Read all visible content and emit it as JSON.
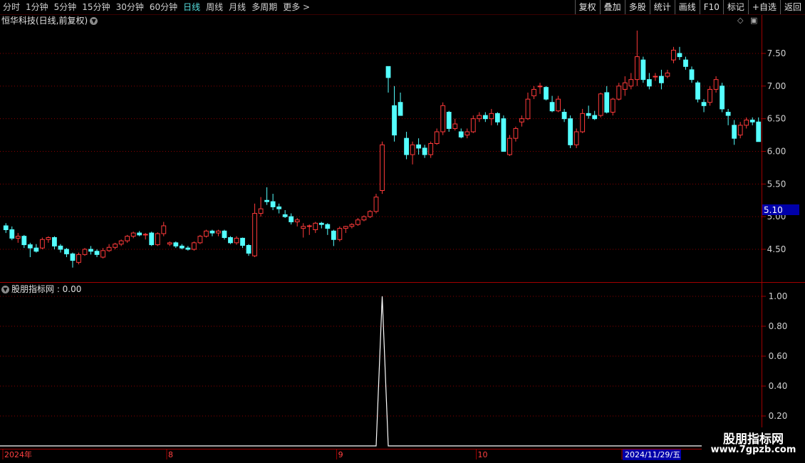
{
  "toolbar": {
    "periods": [
      "分时",
      "1分钟",
      "5分钟",
      "15分钟",
      "30分钟",
      "60分钟",
      "日线",
      "周线",
      "月线",
      "多周期",
      "更多 >"
    ],
    "active_period": "日线",
    "tools": [
      "复权",
      "叠加",
      "多股",
      "统计",
      "画线",
      "F10",
      "标记",
      "+自选",
      "返回"
    ]
  },
  "main_chart": {
    "title": "恒华科技(日线,前复权)",
    "price_axis_ticks": [
      "7.50",
      "7.00",
      "6.50",
      "6.00",
      "5.50",
      "5.00",
      "4.50"
    ],
    "current_price_label": "5.10"
  },
  "indicator": {
    "title": "股朋指标网 : 0.00",
    "axis_ticks": [
      "1.00",
      "0.80",
      "0.60",
      "0.40",
      "0.20"
    ]
  },
  "date_axis": {
    "labels": [
      "2024年",
      "8",
      "9",
      "10",
      "11"
    ],
    "cursor_date": "2024/11/29/五"
  },
  "watermark": {
    "line1": "股朋指标网",
    "line2": "www.7gpzb.com"
  },
  "colors": {
    "up": "#ff3a3a",
    "down": "#54ffff",
    "grid": "#8b0000",
    "axis_text": "#d0d0d0",
    "cursor_box": "#0000aa"
  },
  "chart_data": [
    {
      "type": "candlestick",
      "title": "恒华科技(日线,前复权)",
      "ylim": [
        4.1,
        8.0
      ],
      "y_ticks": [
        4.5,
        5.0,
        5.5,
        6.0,
        6.5,
        7.0,
        7.5
      ],
      "ohlc": [
        [
          4.86,
          4.9,
          4.75,
          4.8
        ],
        [
          4.8,
          4.85,
          4.64,
          4.67
        ],
        [
          4.67,
          4.75,
          4.6,
          4.7
        ],
        [
          4.7,
          4.72,
          4.52,
          4.57
        ],
        [
          4.57,
          4.6,
          4.38,
          4.52
        ],
        [
          4.52,
          4.58,
          4.45,
          4.47
        ],
        [
          4.52,
          4.68,
          4.5,
          4.65
        ],
        [
          4.65,
          4.7,
          4.6,
          4.68
        ],
        [
          4.68,
          4.7,
          4.5,
          4.55
        ],
        [
          4.55,
          4.58,
          4.45,
          4.5
        ],
        [
          4.5,
          4.52,
          4.38,
          4.43
        ],
        [
          4.43,
          4.45,
          4.22,
          4.33
        ],
        [
          4.3,
          4.45,
          4.27,
          4.42
        ],
        [
          4.42,
          4.52,
          4.4,
          4.5
        ],
        [
          4.5,
          4.55,
          4.42,
          4.47
        ],
        [
          4.47,
          4.5,
          4.38,
          4.42
        ],
        [
          4.38,
          4.52,
          4.36,
          4.48
        ],
        [
          4.48,
          4.58,
          4.46,
          4.53
        ],
        [
          4.53,
          4.6,
          4.5,
          4.58
        ],
        [
          4.58,
          4.65,
          4.55,
          4.63
        ],
        [
          4.63,
          4.72,
          4.6,
          4.7
        ],
        [
          4.7,
          4.77,
          4.67,
          4.75
        ],
        [
          4.75,
          4.78,
          4.7,
          4.72
        ],
        [
          4.72,
          4.75,
          4.65,
          4.73
        ],
        [
          4.75,
          4.77,
          4.55,
          4.57
        ],
        [
          4.57,
          4.76,
          4.55,
          4.74
        ],
        [
          4.74,
          4.92,
          4.7,
          4.86
        ],
        [
          4.58,
          4.62,
          4.55,
          4.6
        ],
        [
          4.6,
          4.62,
          4.52,
          4.55
        ],
        [
          4.55,
          4.58,
          4.5,
          4.52
        ],
        [
          4.52,
          4.55,
          4.48,
          4.5
        ],
        [
          4.5,
          4.62,
          4.48,
          4.6
        ],
        [
          4.6,
          4.72,
          4.58,
          4.7
        ],
        [
          4.7,
          4.8,
          4.68,
          4.78
        ],
        [
          4.78,
          4.8,
          4.7,
          4.75
        ],
        [
          4.75,
          4.8,
          4.7,
          4.78
        ],
        [
          4.78,
          4.8,
          4.65,
          4.68
        ],
        [
          4.68,
          4.7,
          4.58,
          4.6
        ],
        [
          4.6,
          4.7,
          4.57,
          4.67
        ],
        [
          4.67,
          4.68,
          4.52,
          4.56
        ],
        [
          4.56,
          4.58,
          4.4,
          4.44
        ],
        [
          4.4,
          5.2,
          4.38,
          5.05
        ],
        [
          5.05,
          5.3,
          5.0,
          5.12
        ],
        [
          5.25,
          5.45,
          5.18,
          5.23
        ],
        [
          5.23,
          5.35,
          5.1,
          5.15
        ],
        [
          5.15,
          5.2,
          5.05,
          5.12
        ],
        [
          5.03,
          5.1,
          4.98,
          5.0
        ],
        [
          5.0,
          5.05,
          4.88,
          4.92
        ],
        [
          4.92,
          4.98,
          4.85,
          4.95
        ],
        [
          4.82,
          4.9,
          4.68,
          4.85
        ],
        [
          4.85,
          4.88,
          4.72,
          4.86
        ],
        [
          4.8,
          4.92,
          4.75,
          4.9
        ],
        [
          4.9,
          4.92,
          4.82,
          4.88
        ],
        [
          4.88,
          4.9,
          4.72,
          4.82
        ],
        [
          4.78,
          4.8,
          4.55,
          4.65
        ],
        [
          4.65,
          4.85,
          4.62,
          4.82
        ],
        [
          4.82,
          4.86,
          4.75,
          4.85
        ],
        [
          4.85,
          4.9,
          4.82,
          4.88
        ],
        [
          4.88,
          4.98,
          4.86,
          4.95
        ],
        [
          4.95,
          5.02,
          4.93,
          5.0
        ],
        [
          5.0,
          5.1,
          4.98,
          5.08
        ],
        [
          5.08,
          5.35,
          5.05,
          5.3
        ],
        [
          5.4,
          6.15,
          5.35,
          6.1
        ],
        [
          7.3,
          7.3,
          6.9,
          7.13
        ],
        [
          6.7,
          7.0,
          6.15,
          6.25
        ],
        [
          6.75,
          6.9,
          6.55,
          6.55
        ],
        [
          6.2,
          6.3,
          5.88,
          5.95
        ],
        [
          5.95,
          6.15,
          5.8,
          6.1
        ],
        [
          6.1,
          6.2,
          5.95,
          6.05
        ],
        [
          6.05,
          6.1,
          5.9,
          5.95
        ],
        [
          5.95,
          6.15,
          5.9,
          6.12
        ],
        [
          6.12,
          6.35,
          6.1,
          6.3
        ],
        [
          6.3,
          6.75,
          6.25,
          6.7
        ],
        [
          6.6,
          6.62,
          6.3,
          6.35
        ],
        [
          6.35,
          6.5,
          6.32,
          6.42
        ],
        [
          6.3,
          6.35,
          6.2,
          6.22
        ],
        [
          6.25,
          6.35,
          6.2,
          6.3
        ],
        [
          6.3,
          6.55,
          6.28,
          6.5
        ],
        [
          6.5,
          6.6,
          6.45,
          6.55
        ],
        [
          6.55,
          6.6,
          6.45,
          6.5
        ],
        [
          6.5,
          6.65,
          6.4,
          6.58
        ],
        [
          6.58,
          6.6,
          6.4,
          6.45
        ],
        [
          6.5,
          6.55,
          6.0,
          6.0
        ],
        [
          5.95,
          6.25,
          5.93,
          6.2
        ],
        [
          6.2,
          6.38,
          6.15,
          6.35
        ],
        [
          6.45,
          6.55,
          6.38,
          6.5
        ],
        [
          6.5,
          6.9,
          6.48,
          6.8
        ],
        [
          6.85,
          7.0,
          6.8,
          6.95
        ],
        [
          7.0,
          7.05,
          6.88,
          7.0
        ],
        [
          6.98,
          7.0,
          6.78,
          6.8
        ],
        [
          6.75,
          6.85,
          6.6,
          6.62
        ],
        [
          6.62,
          6.85,
          6.6,
          6.8
        ],
        [
          6.6,
          6.65,
          6.45,
          6.5
        ],
        [
          6.5,
          6.55,
          6.05,
          6.1
        ],
        [
          6.1,
          6.35,
          6.05,
          6.3
        ],
        [
          6.3,
          6.65,
          6.28,
          6.58
        ],
        [
          6.58,
          6.7,
          6.5,
          6.55
        ],
        [
          6.55,
          6.62,
          6.48,
          6.5
        ],
        [
          6.55,
          6.9,
          6.52,
          6.88
        ],
        [
          6.9,
          7.0,
          6.58,
          6.6
        ],
        [
          6.6,
          6.82,
          6.55,
          6.8
        ],
        [
          6.8,
          7.05,
          6.78,
          7.0
        ],
        [
          6.95,
          7.15,
          6.85,
          7.05
        ],
        [
          7.0,
          7.2,
          6.95,
          7.1
        ],
        [
          7.1,
          7.85,
          7.0,
          7.45
        ],
        [
          7.4,
          7.45,
          7.05,
          7.1
        ],
        [
          7.1,
          7.2,
          6.95,
          7.0
        ],
        [
          7.15,
          7.2,
          7.08,
          7.15
        ],
        [
          7.15,
          7.25,
          6.95,
          7.05
        ],
        [
          7.15,
          7.25,
          7.12,
          7.2
        ],
        [
          7.4,
          7.6,
          7.35,
          7.55
        ],
        [
          7.5,
          7.6,
          7.4,
          7.45
        ],
        [
          7.4,
          7.45,
          7.25,
          7.3
        ],
        [
          7.25,
          7.3,
          7.05,
          7.1
        ],
        [
          7.05,
          7.08,
          6.75,
          6.8
        ],
        [
          6.75,
          6.8,
          6.6,
          6.7
        ],
        [
          6.75,
          7.0,
          6.7,
          6.95
        ],
        [
          6.95,
          7.15,
          6.9,
          7.1
        ],
        [
          7.0,
          7.05,
          6.6,
          6.65
        ],
        [
          6.6,
          6.65,
          6.4,
          6.55
        ],
        [
          6.4,
          6.48,
          6.1,
          6.2
        ],
        [
          6.25,
          6.45,
          6.2,
          6.4
        ],
        [
          6.4,
          6.52,
          6.35,
          6.48
        ],
        [
          6.48,
          6.52,
          6.4,
          6.45
        ],
        [
          6.45,
          6.52,
          6.15,
          6.15
        ]
      ]
    },
    {
      "type": "line",
      "title": "股朋指标网",
      "ylim": [
        0,
        1.05
      ],
      "y_ticks": [
        0.2,
        0.4,
        0.6,
        0.8,
        1.0
      ],
      "values": [
        0,
        0,
        0,
        0,
        0,
        0,
        0,
        0,
        0,
        0,
        0,
        0,
        0,
        0,
        0,
        0,
        0,
        0,
        0,
        0,
        0,
        0,
        0,
        0,
        0,
        0,
        0,
        0,
        0,
        0,
        0,
        0,
        0,
        0,
        0,
        0,
        0,
        0,
        0,
        0,
        0,
        0,
        0,
        0,
        0,
        0,
        0,
        0,
        0,
        0,
        0,
        0,
        0,
        0,
        0,
        0,
        0,
        0,
        0,
        0,
        0,
        0,
        1,
        0,
        0,
        0,
        0,
        0,
        0,
        0,
        0,
        0,
        0,
        0,
        0,
        0,
        0,
        0,
        0,
        0,
        0,
        0,
        0,
        0,
        0,
        0,
        0,
        0,
        0,
        0,
        0,
        0,
        0,
        0,
        0,
        0,
        0,
        0,
        0,
        0,
        0,
        0,
        0,
        0,
        0,
        0,
        0,
        0,
        0,
        0,
        0,
        0,
        0,
        0,
        0,
        0,
        0,
        0,
        0,
        0,
        0,
        0,
        0,
        0,
        0
      ]
    }
  ]
}
